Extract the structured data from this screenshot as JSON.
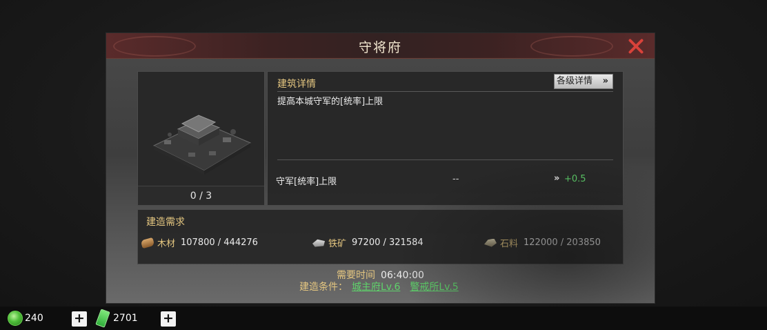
{
  "dialog": {
    "title": "守将府"
  },
  "building": {
    "count": "0 / 3"
  },
  "details": {
    "section_title": "建筑详情",
    "levels_button": "各级详情",
    "levels_button_icon": "»",
    "description": "提高本城守军的[统率]上限",
    "stat": {
      "label": "守军[统率]上限",
      "current": "--",
      "arrow": "»",
      "next": "+0.5"
    }
  },
  "requirements": {
    "section_title": "建造需求",
    "resources": [
      {
        "icon": "wood-icon",
        "name": "木材",
        "value": "107800 / 444276"
      },
      {
        "icon": "iron-icon",
        "name": "铁矿",
        "value": "97200 / 321584"
      },
      {
        "icon": "stone-icon",
        "name": "石料",
        "value": "122000 / 203850"
      }
    ]
  },
  "build_time": {
    "label": "需要时间",
    "value": "06:40:00"
  },
  "conditions": {
    "label": "建造条件：",
    "links": [
      "城主府Lv.6",
      "警戒所Lv.5"
    ]
  },
  "currencies": [
    {
      "icon": "jade-icon",
      "value": "240",
      "plus": "+"
    },
    {
      "icon": "ticket-icon",
      "value": "2701",
      "plus": "+"
    }
  ],
  "colors": {
    "accent_gold": "#e4c680",
    "positive_green": "#5fd36b",
    "close_red": "#d8423a"
  }
}
